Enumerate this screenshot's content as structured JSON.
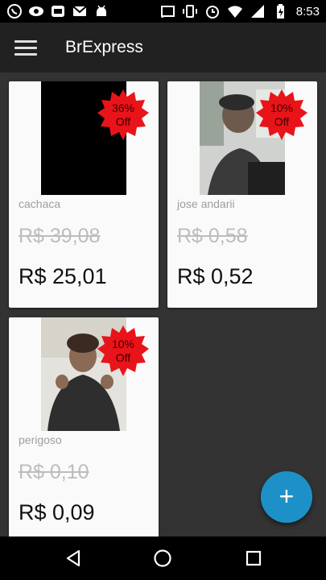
{
  "status_bar": {
    "time": "8:53",
    "left_icons": [
      "whatsapp-icon",
      "eye-icon",
      "browser-icon",
      "mail-icon",
      "android-icon"
    ],
    "right_icons": [
      "cast-icon",
      "vibrate-icon",
      "alarm-icon",
      "wifi-icon",
      "signal-icon",
      "battery-charging-icon"
    ]
  },
  "app_bar": {
    "title": "BrExpress",
    "menu_icon": "hamburger-menu-icon"
  },
  "products": [
    {
      "name": "cachaca",
      "old_price": "R$ 39,08",
      "new_price": "R$ 25,01",
      "discount_line1": "36%",
      "discount_line2": "Off"
    },
    {
      "name": "jose andarii",
      "old_price": "R$ 0,58",
      "new_price": "R$ 0,52",
      "discount_line1": "10%",
      "discount_line2": "Off"
    },
    {
      "name": "perigoso",
      "old_price": "R$ 0,10",
      "new_price": "R$ 0,09",
      "discount_line1": "10%",
      "discount_line2": "Off"
    }
  ],
  "fab": {
    "label": "+",
    "icon": "add-icon"
  },
  "nav_bar": {
    "icons": [
      "back-icon",
      "home-icon",
      "recents-icon"
    ]
  },
  "colors": {
    "app_bar": "#212121",
    "background": "#333333",
    "card": "#fafafa",
    "fab": "#1e90c8",
    "badge": "#e8141a"
  }
}
